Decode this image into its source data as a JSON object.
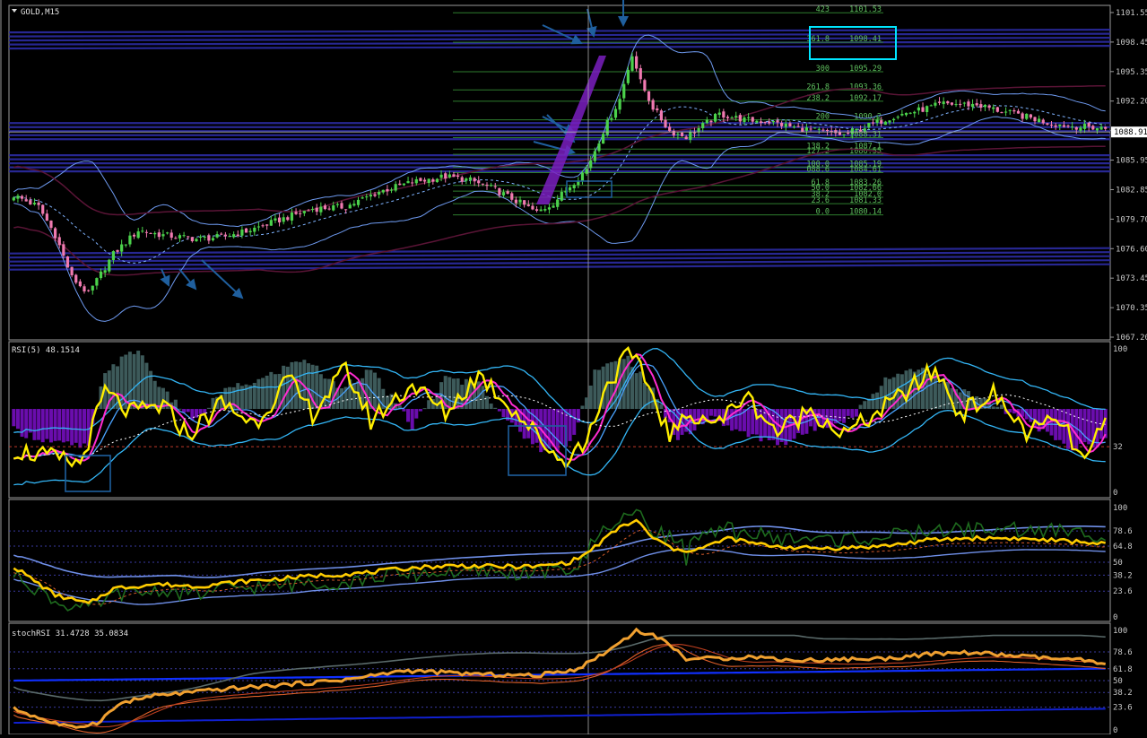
{
  "chart_data": [
    {
      "type": "candlestick",
      "title": "GOLD,M15",
      "symbol": "GOLD",
      "timeframe": "M15",
      "ylim": [
        1067.2,
        1101.55
      ],
      "yticks": [
        "1101.55",
        "1098.45",
        "1095.35",
        "1092.20",
        "1089.10",
        "1085.95",
        "1082.85",
        "1079.70",
        "1076.60",
        "1073.45",
        "1070.35",
        "1067.20"
      ],
      "current_price": "1088.91",
      "current_price_value": 1088.91,
      "close_anchors": [
        [
          0,
          1082.2
        ],
        [
          6,
          1081.0
        ],
        [
          10,
          1078.0
        ],
        [
          14,
          1073.5
        ],
        [
          18,
          1071.8
        ],
        [
          24,
          1076.0
        ],
        [
          30,
          1078.5
        ],
        [
          36,
          1078.0
        ],
        [
          44,
          1077.6
        ],
        [
          50,
          1077.8
        ],
        [
          56,
          1078.4
        ],
        [
          64,
          1079.6
        ],
        [
          72,
          1080.8
        ],
        [
          80,
          1081.0
        ],
        [
          88,
          1082.6
        ],
        [
          96,
          1083.6
        ],
        [
          104,
          1084.2
        ],
        [
          110,
          1083.8
        ],
        [
          116,
          1082.8
        ],
        [
          122,
          1081.4
        ],
        [
          126,
          1080.4
        ],
        [
          130,
          1081.4
        ],
        [
          134,
          1083.2
        ],
        [
          138,
          1085.0
        ],
        [
          142,
          1089.0
        ],
        [
          146,
          1092.4
        ],
        [
          149,
          1097.2
        ],
        [
          151,
          1094.2
        ],
        [
          154,
          1091.5
        ],
        [
          158,
          1089.0
        ],
        [
          162,
          1088.4
        ],
        [
          166,
          1089.6
        ],
        [
          170,
          1090.8
        ],
        [
          176,
          1090.2
        ],
        [
          182,
          1090.0
        ],
        [
          188,
          1089.4
        ],
        [
          194,
          1089.0
        ],
        [
          200,
          1088.6
        ],
        [
          206,
          1089.6
        ],
        [
          212,
          1090.6
        ],
        [
          218,
          1091.2
        ],
        [
          224,
          1091.9
        ],
        [
          232,
          1091.8
        ],
        [
          238,
          1091.1
        ],
        [
          244,
          1090.5
        ],
        [
          250,
          1089.8
        ],
        [
          256,
          1089.5
        ],
        [
          263,
          1089.3
        ]
      ],
      "fibonacci": [
        {
          "level": "423",
          "price": "1101.53",
          "value": 1101.53
        },
        {
          "level": "361.8",
          "price": "1098.41",
          "value": 1098.41
        },
        {
          "level": "300",
          "price": "1095.29",
          "value": 1095.29
        },
        {
          "level": "261.8",
          "price": "1093.36",
          "value": 1093.36
        },
        {
          "level": "238.2",
          "price": "1092.17",
          "value": 1092.17
        },
        {
          "level": "200",
          "price": "1090.2",
          "value": 1090.2
        },
        {
          "level": "",
          "price": "1088.31",
          "value": 1088.31
        },
        {
          "level": "138.2",
          "price": "1087.1",
          "value": 1087.1
        },
        {
          "level": "127.2",
          "price": "1086.55",
          "value": 1086.55
        },
        {
          "level": "100.0",
          "price": "1085.19",
          "value": 1085.19
        },
        {
          "level": "088.6",
          "price": "1084.61",
          "value": 1084.61
        },
        {
          "level": "61.8",
          "price": "1083.26",
          "value": 1083.26
        },
        {
          "level": "50.0",
          "price": "1082.66",
          "value": 1082.66
        },
        {
          "level": "38.2",
          "price": "1082.0",
          "value": 1082.0
        },
        {
          "level": "23.6",
          "price": "1081.33",
          "value": 1081.33
        },
        {
          "level": "0.0",
          "price": "1080.14",
          "value": 1080.14
        }
      ],
      "sr_bands": [
        1098.6,
        1089.0,
        1085.6,
        1075.2
      ],
      "colors": {
        "bull": "#4bd24b",
        "bear": "#f07ab0",
        "band": "#2a2a9a",
        "bollinger": "#6e9af0",
        "envelope": "#5a1436",
        "fib": "#2e7d2e",
        "fib_text": "#5fbf5f",
        "annotation": "#1f5f9e",
        "highlight": "#00e5ff"
      }
    },
    {
      "type": "line",
      "title": "RSI(5) 48.1514",
      "ylim": [
        0,
        100
      ],
      "yticks": [
        "100",
        "32",
        "0"
      ],
      "level": 32,
      "rsi_anchors": [
        [
          0,
          30
        ],
        [
          8,
          25
        ],
        [
          16,
          20
        ],
        [
          22,
          70
        ],
        [
          28,
          55
        ],
        [
          36,
          60
        ],
        [
          42,
          40
        ],
        [
          50,
          62
        ],
        [
          58,
          48
        ],
        [
          66,
          78
        ],
        [
          72,
          55
        ],
        [
          80,
          85
        ],
        [
          86,
          50
        ],
        [
          96,
          75
        ],
        [
          104,
          55
        ],
        [
          112,
          82
        ],
        [
          118,
          65
        ],
        [
          126,
          40
        ],
        [
          132,
          22
        ],
        [
          138,
          35
        ],
        [
          142,
          70
        ],
        [
          148,
          96
        ],
        [
          152,
          80
        ],
        [
          158,
          40
        ],
        [
          164,
          55
        ],
        [
          170,
          48
        ],
        [
          176,
          68
        ],
        [
          184,
          42
        ],
        [
          192,
          58
        ],
        [
          200,
          40
        ],
        [
          208,
          55
        ],
        [
          216,
          72
        ],
        [
          222,
          85
        ],
        [
          228,
          55
        ],
        [
          236,
          68
        ],
        [
          244,
          42
        ],
        [
          252,
          50
        ],
        [
          258,
          20
        ],
        [
          264,
          55
        ],
        [
          270,
          48
        ]
      ],
      "hist_anchors": [
        [
          0,
          -25
        ],
        [
          10,
          -40
        ],
        [
          18,
          -45
        ],
        [
          22,
          45
        ],
        [
          30,
          70
        ],
        [
          36,
          20
        ],
        [
          44,
          -15
        ],
        [
          50,
          20
        ],
        [
          60,
          35
        ],
        [
          70,
          60
        ],
        [
          78,
          25
        ],
        [
          86,
          45
        ],
        [
          96,
          -20
        ],
        [
          104,
          35
        ],
        [
          112,
          30
        ],
        [
          120,
          -20
        ],
        [
          128,
          -50
        ],
        [
          134,
          -40
        ],
        [
          140,
          45
        ],
        [
          148,
          60
        ],
        [
          154,
          20
        ],
        [
          160,
          -35
        ],
        [
          168,
          -10
        ],
        [
          176,
          -30
        ],
        [
          186,
          -40
        ],
        [
          194,
          -20
        ],
        [
          202,
          -10
        ],
        [
          210,
          35
        ],
        [
          218,
          50
        ],
        [
          226,
          25
        ],
        [
          234,
          10
        ],
        [
          244,
          -15
        ],
        [
          254,
          -45
        ],
        [
          262,
          -40
        ],
        [
          270,
          -25
        ]
      ]
    },
    {
      "type": "line",
      "ylim": [
        0,
        100
      ],
      "yticks": [
        "100",
        "78.6",
        "64.8",
        "50",
        "38.2",
        "23.6",
        "0"
      ],
      "main_anchors": [
        [
          0,
          46
        ],
        [
          10,
          20
        ],
        [
          18,
          12
        ],
        [
          24,
          26
        ],
        [
          34,
          30
        ],
        [
          44,
          28
        ],
        [
          54,
          32
        ],
        [
          64,
          35
        ],
        [
          74,
          38
        ],
        [
          84,
          40
        ],
        [
          96,
          45
        ],
        [
          106,
          47
        ],
        [
          116,
          46
        ],
        [
          126,
          46
        ],
        [
          134,
          50
        ],
        [
          138,
          58
        ],
        [
          142,
          70
        ],
        [
          146,
          82
        ],
        [
          150,
          88
        ],
        [
          154,
          72
        ],
        [
          160,
          60
        ],
        [
          166,
          63
        ],
        [
          172,
          72
        ],
        [
          180,
          66
        ],
        [
          190,
          63
        ],
        [
          200,
          63
        ],
        [
          210,
          65
        ],
        [
          220,
          70
        ],
        [
          230,
          72
        ],
        [
          240,
          72
        ],
        [
          250,
          70
        ],
        [
          260,
          68
        ],
        [
          270,
          63
        ]
      ]
    },
    {
      "type": "line",
      "title": "stochRSI 31.4728 35.0834",
      "ylim": [
        0,
        100
      ],
      "yticks": [
        "100",
        "78.6",
        "61.8",
        "50",
        "38.2",
        "23.6",
        "0"
      ],
      "main_anchors": [
        [
          0,
          22
        ],
        [
          8,
          10
        ],
        [
          14,
          3
        ],
        [
          20,
          8
        ],
        [
          26,
          28
        ],
        [
          34,
          35
        ],
        [
          42,
          38
        ],
        [
          52,
          42
        ],
        [
          62,
          45
        ],
        [
          72,
          48
        ],
        [
          82,
          52
        ],
        [
          94,
          60
        ],
        [
          104,
          58
        ],
        [
          114,
          56
        ],
        [
          126,
          55
        ],
        [
          136,
          62
        ],
        [
          144,
          82
        ],
        [
          150,
          100
        ],
        [
          156,
          92
        ],
        [
          162,
          72
        ],
        [
          170,
          72
        ],
        [
          178,
          74
        ],
        [
          188,
          70
        ],
        [
          198,
          71
        ],
        [
          210,
          72
        ],
        [
          220,
          76
        ],
        [
          230,
          78
        ],
        [
          240,
          75
        ],
        [
          250,
          72
        ],
        [
          258,
          70
        ],
        [
          266,
          62
        ],
        [
          270,
          58
        ]
      ]
    }
  ]
}
